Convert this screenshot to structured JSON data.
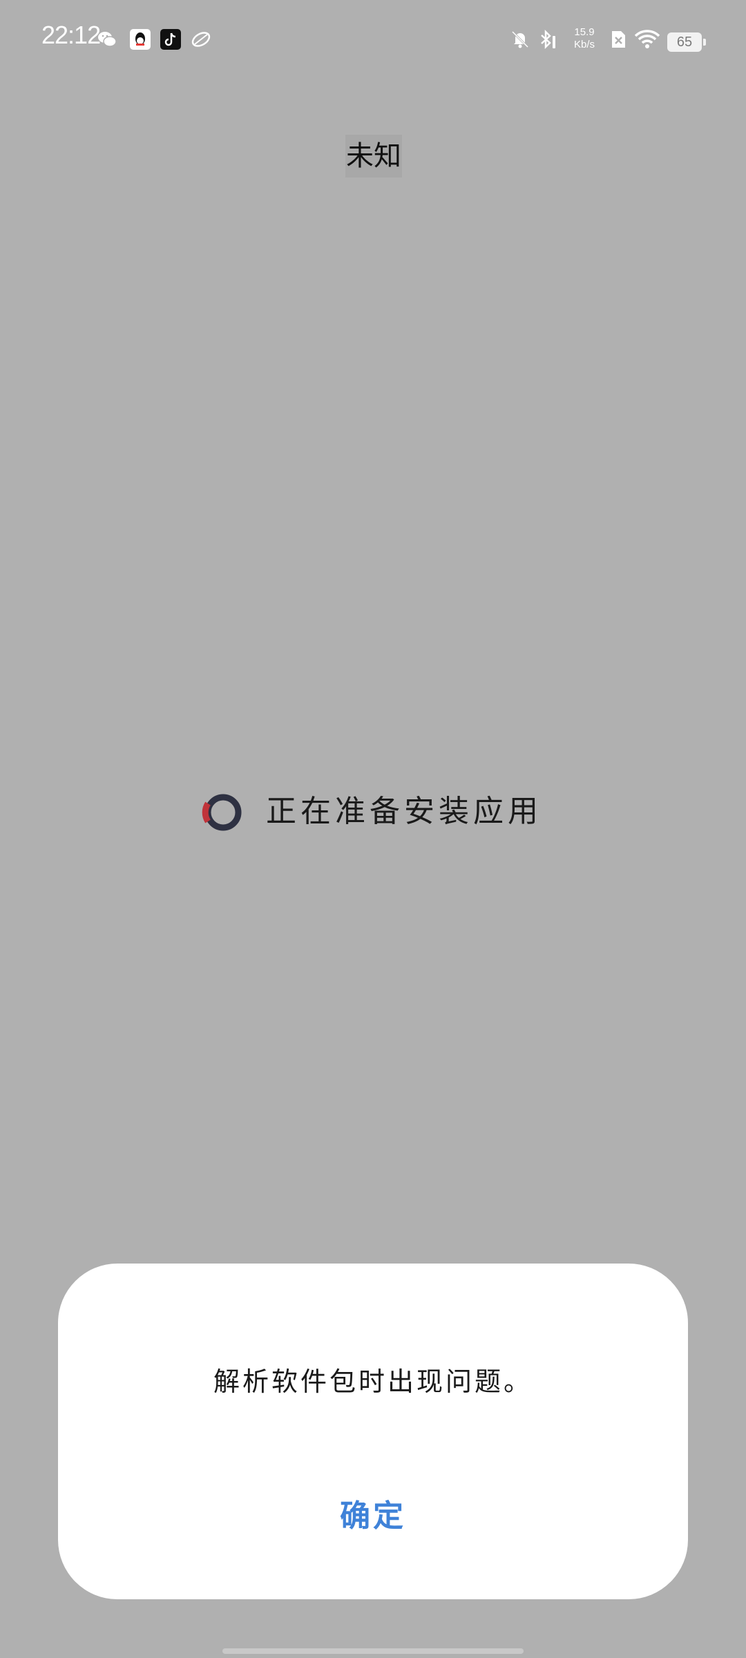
{
  "status_bar": {
    "time": "22:12",
    "net_speed_value": "15.9",
    "net_speed_unit": "Kb/s",
    "battery": "65",
    "icons": [
      "wechat-icon",
      "qq-icon",
      "tiktok-icon",
      "leaf-icon",
      "bell-muted-icon",
      "bluetooth-icon",
      "sim-disabled-icon",
      "wifi-icon"
    ]
  },
  "title": "未知",
  "preparing": {
    "text": "正在准备安装应用",
    "spinner_accent": "#c0333a",
    "spinner_main": "#2e3142"
  },
  "dialog": {
    "message": "解析软件包时出现问题。",
    "confirm_label": "确定",
    "confirm_color": "#3f82d8"
  }
}
